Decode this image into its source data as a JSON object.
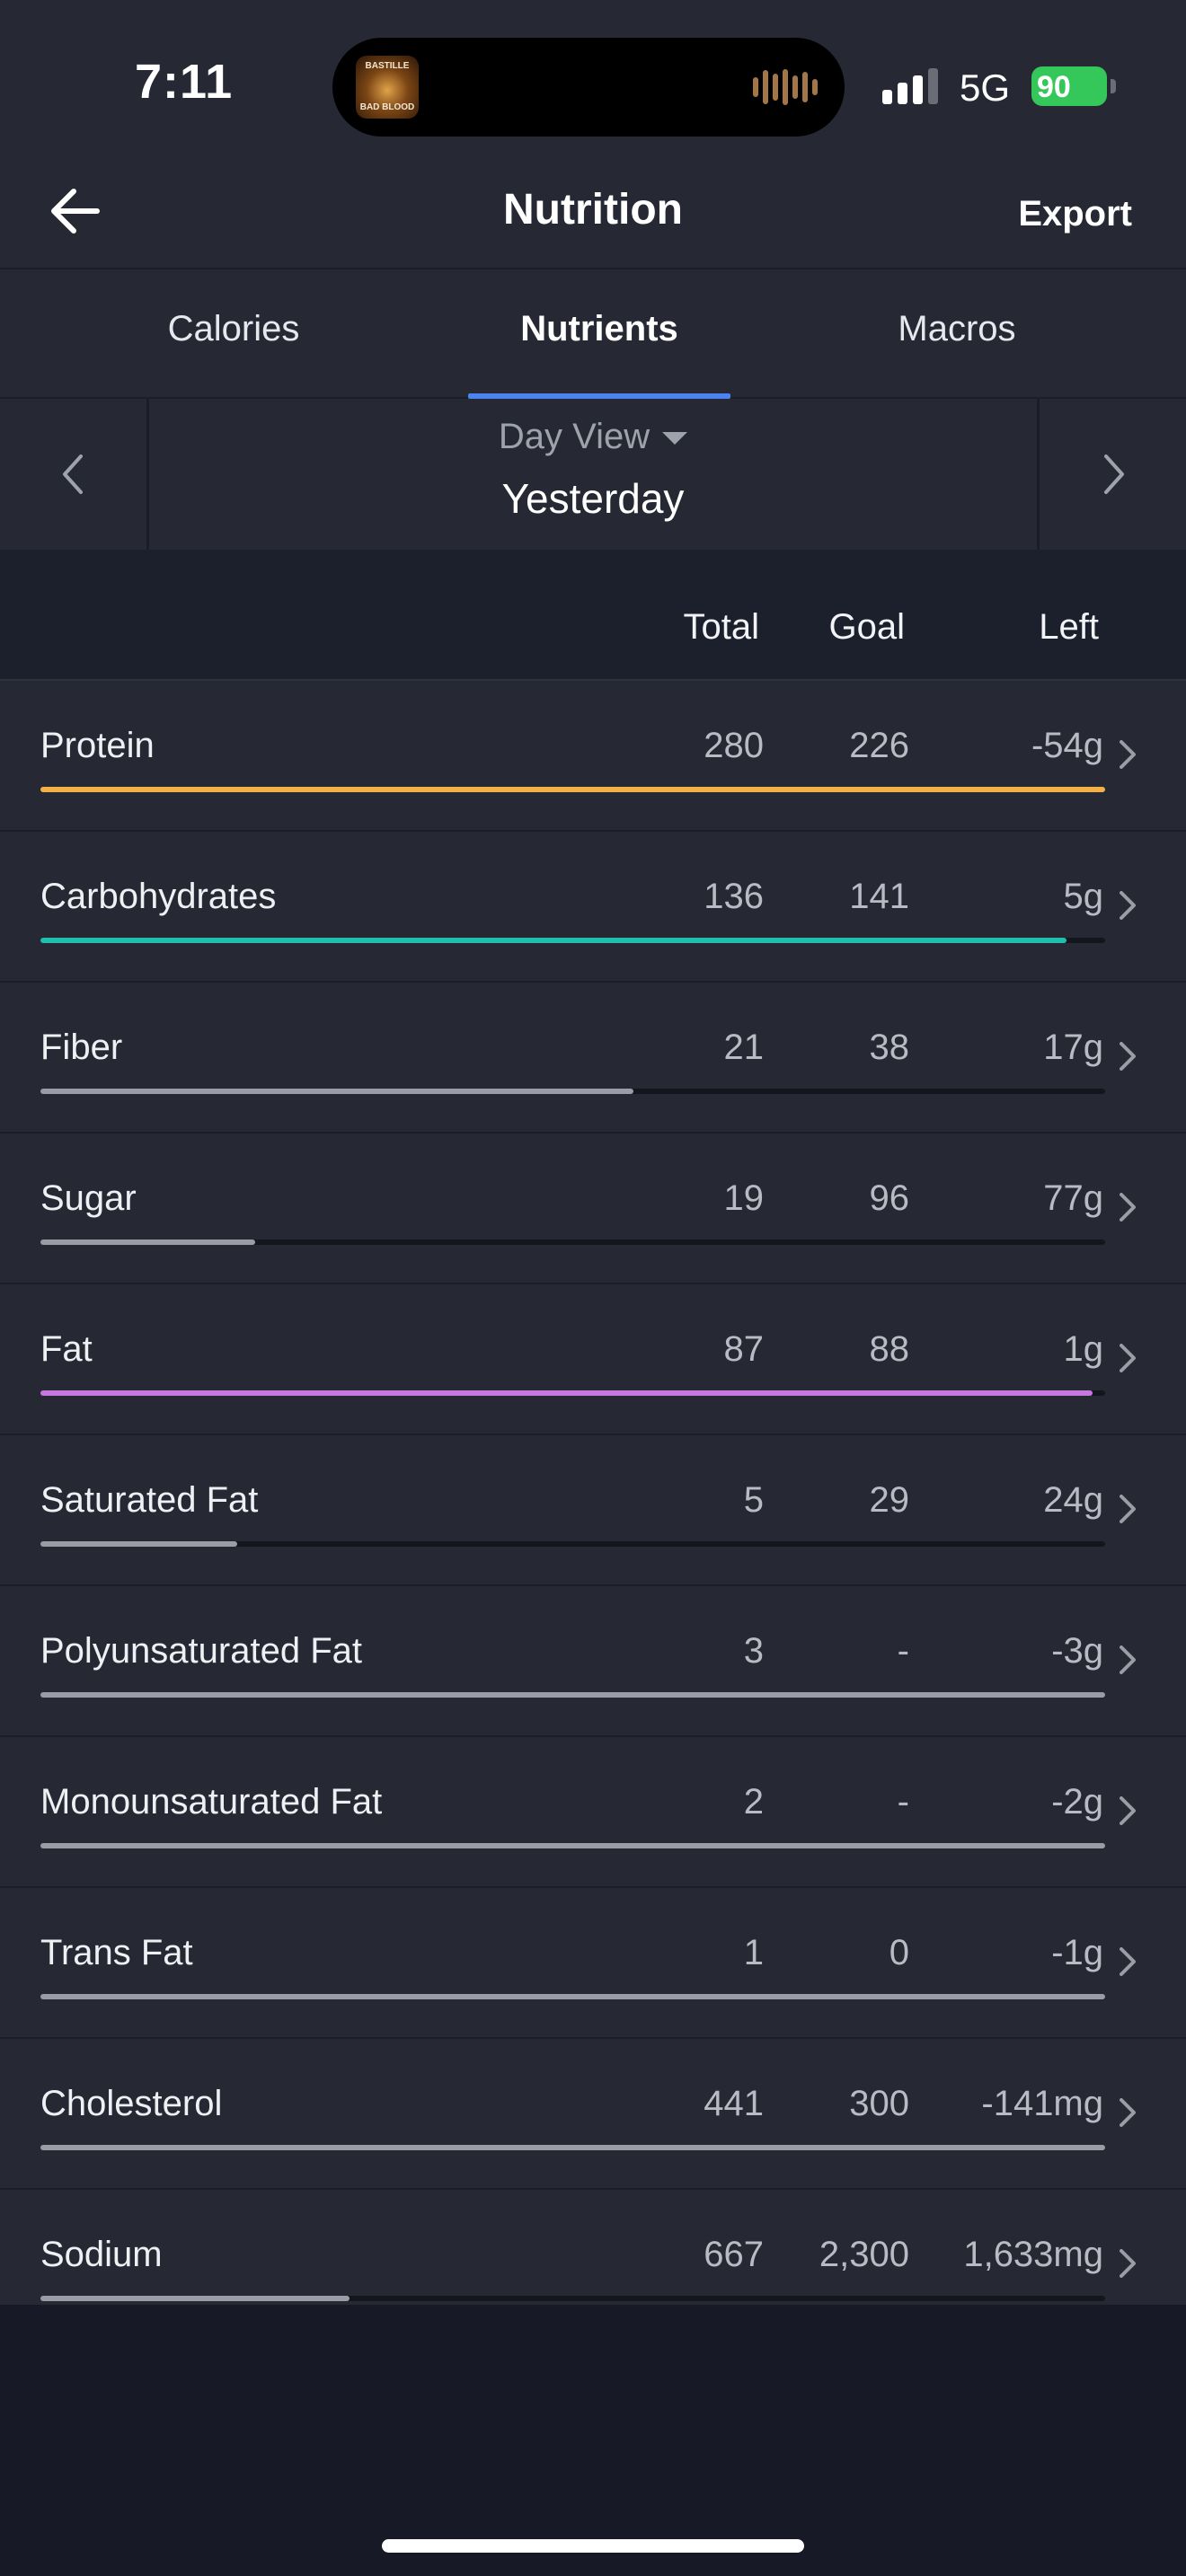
{
  "status": {
    "time": "7:11",
    "network": "5G",
    "battery": "90",
    "album_top": "BASTILLE",
    "album_bottom": "BAD BLOOD"
  },
  "header": {
    "title": "Nutrition",
    "export_label": "Export",
    "back_icon": "arrow-left-icon"
  },
  "tabs": [
    {
      "label": "Calories",
      "active": false
    },
    {
      "label": "Nutrients",
      "active": true
    },
    {
      "label": "Macros",
      "active": false
    }
  ],
  "day_nav": {
    "view_label": "Day View",
    "day_label": "Yesterday"
  },
  "columns": {
    "total": "Total",
    "goal": "Goal",
    "left": "Left"
  },
  "colors": {
    "accent": "#4b83f0",
    "protein": "#f2b146",
    "carbohydrates": "#1fbfae",
    "fat": "#c977e0",
    "neutral": "#9a9da5"
  },
  "nutrients": [
    {
      "name": "Protein",
      "total": "280",
      "goal": "226",
      "left": "-54g",
      "progress": 1.0,
      "color": "#f2b146"
    },
    {
      "name": "Carbohydrates",
      "total": "136",
      "goal": "141",
      "left": "5g",
      "progress": 0.964,
      "color": "#1fbfae"
    },
    {
      "name": "Fiber",
      "total": "21",
      "goal": "38",
      "left": "17g",
      "progress": 0.557,
      "color": "#9a9da5"
    },
    {
      "name": "Sugar",
      "total": "19",
      "goal": "96",
      "left": "77g",
      "progress": 0.202,
      "color": "#9a9da5"
    },
    {
      "name": "Fat",
      "total": "87",
      "goal": "88",
      "left": "1g",
      "progress": 0.988,
      "color": "#c977e0"
    },
    {
      "name": "Saturated Fat",
      "total": "5",
      "goal": "29",
      "left": "24g",
      "progress": 0.185,
      "color": "#9a9da5"
    },
    {
      "name": "Polyunsaturated Fat",
      "total": "3",
      "goal": "-",
      "left": "-3g",
      "progress": 1.0,
      "color": "#9a9da5"
    },
    {
      "name": "Monounsaturated Fat",
      "total": "2",
      "goal": "-",
      "left": "-2g",
      "progress": 1.0,
      "color": "#9a9da5"
    },
    {
      "name": "Trans Fat",
      "total": "1",
      "goal": "0",
      "left": "-1g",
      "progress": 1.0,
      "color": "#9a9da5"
    },
    {
      "name": "Cholesterol",
      "total": "441",
      "goal": "300",
      "left": "-141mg",
      "progress": 1.0,
      "color": "#9a9da5"
    },
    {
      "name": "Sodium",
      "total": "667",
      "goal": "2,300",
      "left": "1,633mg",
      "progress": 0.29,
      "color": "#9a9da5"
    }
  ]
}
